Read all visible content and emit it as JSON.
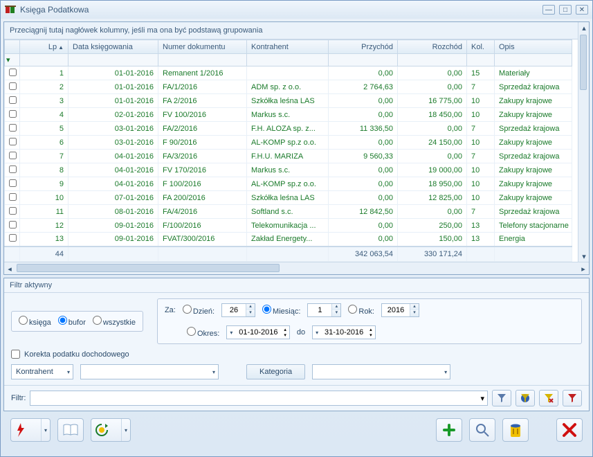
{
  "window": {
    "title": "Księga Podatkowa"
  },
  "grid": {
    "group_hint": "Przeciągnij tutaj nagłówek kolumny, jeśli ma ona być podstawą grupowania",
    "columns": {
      "lp": "Lp",
      "data": "Data księgowania",
      "numer": "Numer dokumentu",
      "kontrahent": "Kontrahent",
      "przychod": "Przychód",
      "rozchod": "Rozchód",
      "kol": "Kol.",
      "opis": "Opis"
    },
    "rows": [
      {
        "lp": "1",
        "data": "01-01-2016",
        "numer": "Remanent 1/2016",
        "kontrahent": "",
        "przychod": "0,00",
        "rozchod": "0,00",
        "kol": "15",
        "opis": "Materiały"
      },
      {
        "lp": "2",
        "data": "01-01-2016",
        "numer": "FA/1/2016",
        "kontrahent": "ADM sp. z o.o.",
        "przychod": "2 764,63",
        "rozchod": "0,00",
        "kol": "7",
        "opis": "Sprzedaż krajowa"
      },
      {
        "lp": "3",
        "data": "01-01-2016",
        "numer": "FA 2/2016",
        "kontrahent": "Szkółka leśna LAS",
        "przychod": "0,00",
        "rozchod": "16 775,00",
        "kol": "10",
        "opis": "Zakupy krajowe"
      },
      {
        "lp": "4",
        "data": "02-01-2016",
        "numer": "FV 100/2016",
        "kontrahent": "Markus s.c.",
        "przychod": "0,00",
        "rozchod": "18 450,00",
        "kol": "10",
        "opis": "Zakupy krajowe"
      },
      {
        "lp": "5",
        "data": "03-01-2016",
        "numer": "FA/2/2016",
        "kontrahent": "F.H. ALOZA sp. z...",
        "przychod": "11 336,50",
        "rozchod": "0,00",
        "kol": "7",
        "opis": "Sprzedaż krajowa"
      },
      {
        "lp": "6",
        "data": "03-01-2016",
        "numer": "F 90/2016",
        "kontrahent": "AL-KOMP sp.z o.o.",
        "przychod": "0,00",
        "rozchod": "24 150,00",
        "kol": "10",
        "opis": "Zakupy krajowe"
      },
      {
        "lp": "7",
        "data": "04-01-2016",
        "numer": "FA/3/2016",
        "kontrahent": "F.H.U. MARIZA",
        "przychod": "9 560,33",
        "rozchod": "0,00",
        "kol": "7",
        "opis": "Sprzedaż krajowa"
      },
      {
        "lp": "8",
        "data": "04-01-2016",
        "numer": "FV 170/2016",
        "kontrahent": "Markus s.c.",
        "przychod": "0,00",
        "rozchod": "19 000,00",
        "kol": "10",
        "opis": "Zakupy krajowe"
      },
      {
        "lp": "9",
        "data": "04-01-2016",
        "numer": "F 100/2016",
        "kontrahent": "AL-KOMP sp.z o.o.",
        "przychod": "0,00",
        "rozchod": "18 950,00",
        "kol": "10",
        "opis": "Zakupy krajowe"
      },
      {
        "lp": "10",
        "data": "07-01-2016",
        "numer": "FA 200/2016",
        "kontrahent": "Szkółka leśna LAS",
        "przychod": "0,00",
        "rozchod": "12 825,00",
        "kol": "10",
        "opis": "Zakupy krajowe"
      },
      {
        "lp": "11",
        "data": "08-01-2016",
        "numer": "FA/4/2016",
        "kontrahent": "Softland s.c.",
        "przychod": "12 842,50",
        "rozchod": "0,00",
        "kol": "7",
        "opis": "Sprzedaż krajowa"
      },
      {
        "lp": "12",
        "data": "09-01-2016",
        "numer": "F/100/2016",
        "kontrahent": "Telekomunikacja ...",
        "przychod": "0,00",
        "rozchod": "250,00",
        "kol": "13",
        "opis": "Telefony stacjonarne"
      },
      {
        "lp": "13",
        "data": "09-01-2016",
        "numer": "FVAT/300/2016",
        "kontrahent": "Zakład Energety...",
        "przychod": "0,00",
        "rozchod": "150,00",
        "kol": "13",
        "opis": "Energia"
      }
    ],
    "totals": {
      "count": "44",
      "przychod": "342 063,54",
      "rozchod": "330 171,24"
    }
  },
  "filter": {
    "title": "Filtr aktywny",
    "radio": {
      "ksiega": "księga",
      "bufor": "bufor",
      "wszystkie": "wszystkie"
    },
    "za_label": "Za:",
    "dzien_label": "Dzień:",
    "dzien_value": "26",
    "miesiac_label": "Miesiąc:",
    "miesiac_value": "1",
    "rok_label": "Rok:",
    "rok_value": "2016",
    "okres_label": "Okres:",
    "date_from": "01-10-2016",
    "do_label": "do",
    "date_to": "31-10-2016",
    "korekta_label": "Korekta podatku dochodowego",
    "kontrahent_label": "Kontrahent",
    "kategoria_label": "Kategoria",
    "filtr_label": "Filtr:"
  }
}
